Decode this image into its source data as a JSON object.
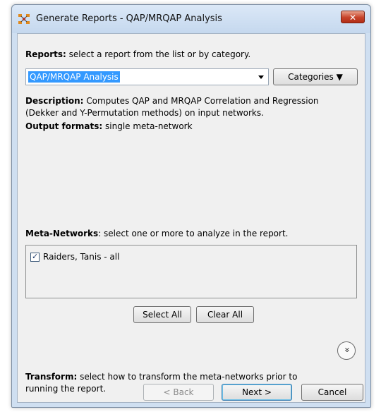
{
  "window": {
    "title": "Generate Reports - QAP/MRQAP Analysis",
    "close_label": "✕"
  },
  "reports": {
    "label_bold": "Reports:",
    "label_rest": " select a report from the list or by category.",
    "selected": "QAP/MRQAP Analysis",
    "categories_button": "Categories ▼",
    "description_bold": "Description:",
    "description_line1": " Computes QAP and MRQAP Correlation and Regression",
    "description_line2": "(Dekker and Y-Permutation methods) on input networks.",
    "output_bold": "Output formats:",
    "output_rest": " single meta-network"
  },
  "meta_networks": {
    "label_bold": "Meta-Networks",
    "label_rest": ": select one or more to analyze in the report.",
    "items": [
      {
        "label": "Raiders, Tanis - all",
        "checked": true
      }
    ],
    "select_all": "Select All",
    "clear_all": "Clear All"
  },
  "transform": {
    "label_bold": "Transform:",
    "label_rest_line1": " select how to transform the meta-networks prior to",
    "label_rest_line2": "running the report.",
    "expand_icon": "double-chevron-down-icon",
    "expand_glyph": "»"
  },
  "footer": {
    "back": "< Back",
    "next": "Next >",
    "cancel": "Cancel"
  }
}
